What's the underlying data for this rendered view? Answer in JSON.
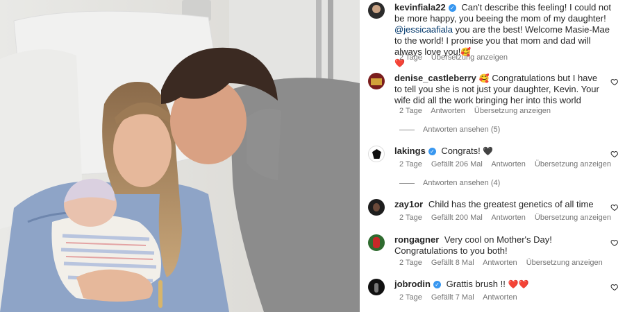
{
  "caption": {
    "username": "kevinfiala22",
    "text_a": "Can't describe this feeling! I could not be more happy, you beeing the mom of my daughter!",
    "mention": "@jessicaafiala",
    "text_b": "you are the best! Welcome Masie-Mae to the world! I promise you that mom and dad will always love you!",
    "emoji_1": "🥰",
    "emoji_2": "❤️",
    "time": "2 Tage",
    "translate": "Übersetzung anzeigen"
  },
  "comments": [
    {
      "username": "denise_castleberry",
      "verified": false,
      "emoji_lead": "🥰",
      "text": "Congratulations but I have to tell you she is not just your daughter, Kevin. Your wife did all the work bringing her into this world",
      "time": "2 Tage",
      "likes": "",
      "reply": "Antworten",
      "translate": "Übersetzung anzeigen",
      "view_replies": "Antworten ansehen (5)"
    },
    {
      "username": "lakings",
      "verified": true,
      "text": "Congrats!",
      "emoji_trail": "🖤",
      "time": "2 Tage",
      "likes": "Gefällt 206 Mal",
      "reply": "Antworten",
      "translate": "Übersetzung anzeigen",
      "view_replies": "Antworten ansehen (4)"
    },
    {
      "username": "zay1or",
      "verified": false,
      "text": "Child has the greatest genetics of all time",
      "time": "2 Tage",
      "likes": "Gefällt 200 Mal",
      "reply": "Antworten",
      "translate": "Übersetzung anzeigen"
    },
    {
      "username": "rongagner",
      "verified": false,
      "text": "Very cool on Mother's Day! Congratulations to you both!",
      "time": "2 Tage",
      "likes": "Gefällt 8 Mal",
      "reply": "Antworten",
      "translate": "Übersetzung anzeigen"
    },
    {
      "username": "jobrodin",
      "verified": true,
      "text": "Grattis brush !!",
      "emoji_trail": "❤️❤️",
      "time": "2 Tage",
      "likes": "Gefällt 7 Mal",
      "reply": "Antworten"
    }
  ],
  "colors": {
    "verified_badge": "#3897f0",
    "mention": "#00376b",
    "meta_text": "#737373"
  },
  "icons": {
    "like": "heart-outline-icon",
    "verified": "verified-badge-icon"
  }
}
